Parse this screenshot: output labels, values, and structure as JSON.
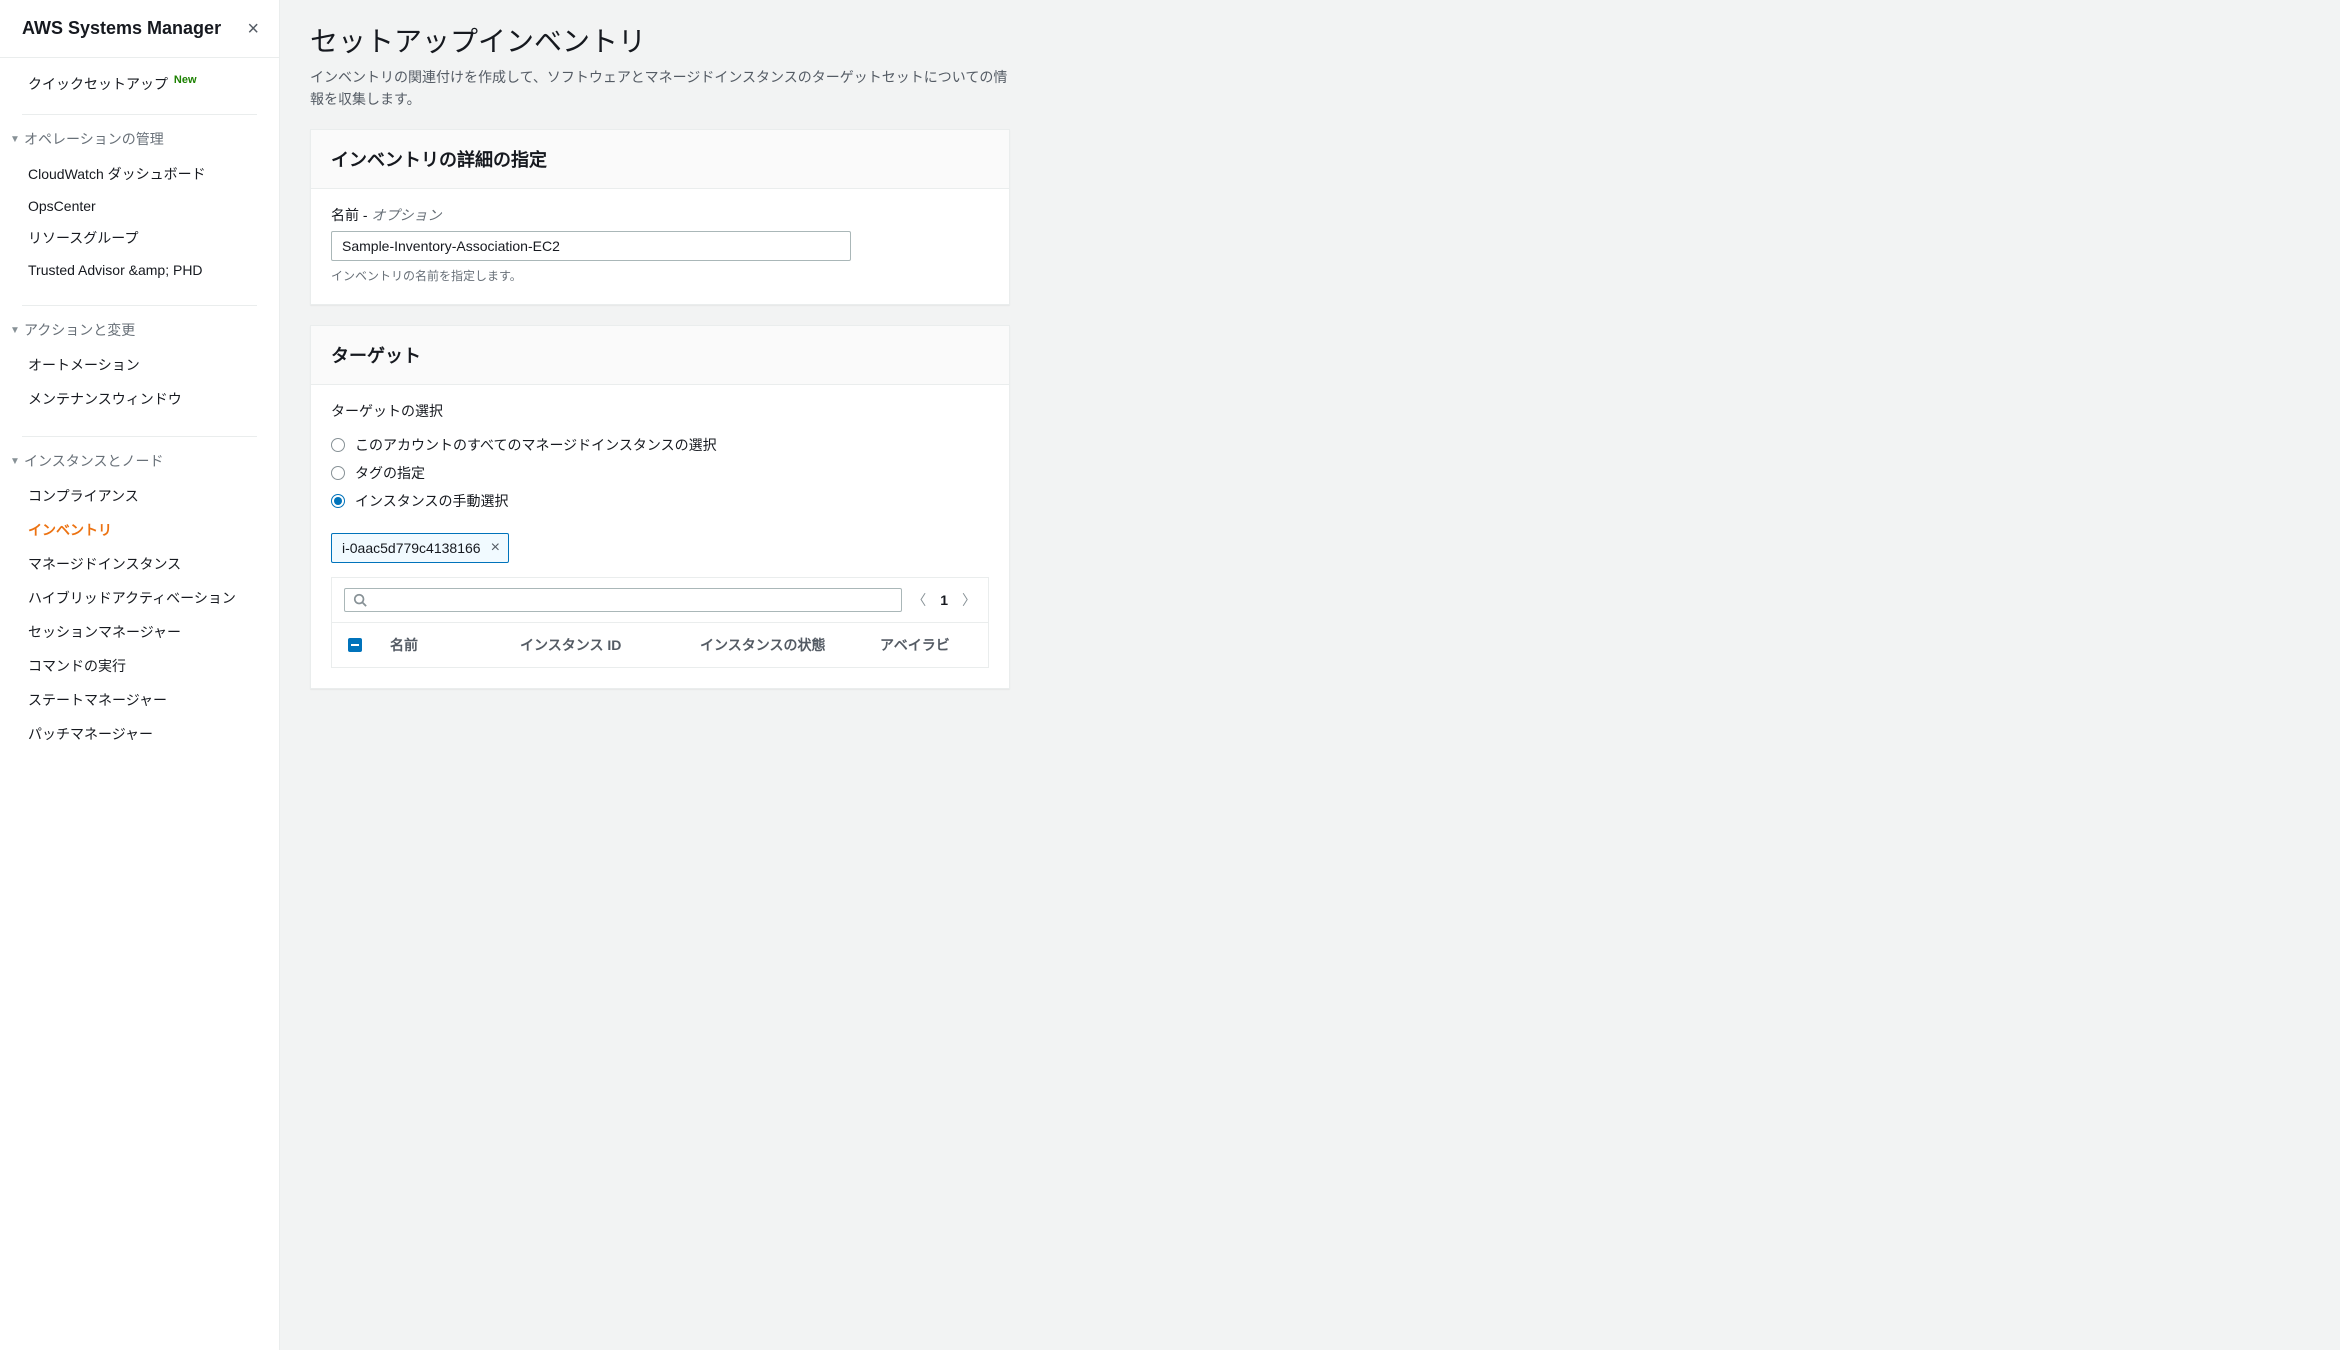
{
  "sidebar": {
    "title": "AWS Systems Manager",
    "quick_setup": "クイックセットアップ",
    "new_badge": "New",
    "groups": [
      {
        "label": "オペレーションの管理",
        "items": [
          {
            "label": "CloudWatch ダッシュボード",
            "active": false
          },
          {
            "label": "OpsCenter",
            "active": false
          },
          {
            "label": "リソースグループ",
            "active": false
          },
          {
            "label": "Trusted Advisor &amp; PHD",
            "active": false
          }
        ]
      },
      {
        "label": "アクションと変更",
        "items": [
          {
            "label": "オートメーション",
            "active": false
          },
          {
            "label": "メンテナンスウィンドウ",
            "active": false
          }
        ]
      },
      {
        "label": "インスタンスとノード",
        "items": [
          {
            "label": "コンプライアンス",
            "active": false
          },
          {
            "label": "インベントリ",
            "active": true
          },
          {
            "label": "マネージドインスタンス",
            "active": false
          },
          {
            "label": "ハイブリッドアクティベーション",
            "active": false
          },
          {
            "label": "セッションマネージャー",
            "active": false
          },
          {
            "label": "コマンドの実行",
            "active": false
          },
          {
            "label": "ステートマネージャー",
            "active": false
          },
          {
            "label": "パッチマネージャー",
            "active": false
          }
        ]
      }
    ]
  },
  "main": {
    "title": "セットアップインベントリ",
    "description": "インベントリの関連付けを作成して、ソフトウェアとマネージドインスタンスのターゲットセットについての情報を収集します。",
    "details_panel": {
      "header": "インベントリの詳細の指定",
      "name_label": "名前 - ",
      "name_optional": "オプション",
      "name_value": "Sample-Inventory-Association-EC2",
      "name_hint": "インベントリの名前を指定します。"
    },
    "targets_panel": {
      "header": "ターゲット",
      "select_label": "ターゲットの選択",
      "radios": [
        {
          "label": "このアカウントのすべてのマネージドインスタンスの選択",
          "selected": false
        },
        {
          "label": "タグの指定",
          "selected": false
        },
        {
          "label": "インスタンスの手動選択",
          "selected": true
        }
      ],
      "token": "i-0aac5d779c4138166",
      "pager": {
        "page": "1"
      },
      "table_headers": {
        "name": "名前",
        "instance_id": "インスタンス ID",
        "state": "インスタンスの状態",
        "az": "アベイラビ"
      }
    }
  }
}
